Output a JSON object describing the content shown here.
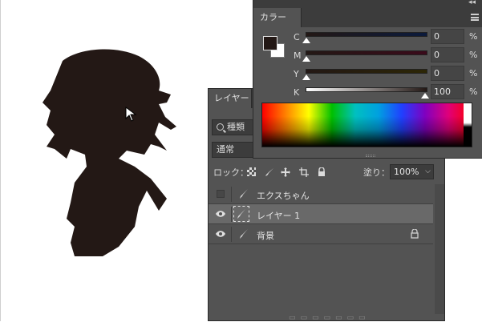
{
  "layers_panel": {
    "tab_label": "レイヤー",
    "kind_label": "種類",
    "blend_mode": "通常",
    "lock_label": "ロック：",
    "fill_label": "塗り：",
    "fill_value": "100%",
    "layers": [
      {
        "name": "エクスちゃん",
        "visible": false,
        "selected": false,
        "locked": false
      },
      {
        "name": "レイヤー 1",
        "visible": true,
        "selected": true,
        "locked": false
      },
      {
        "name": "背景",
        "visible": true,
        "selected": false,
        "locked": true
      }
    ]
  },
  "color_panel": {
    "tab_label": "カラー",
    "foreground_color": "#231815",
    "background_color": "#ffffff",
    "sliders": [
      {
        "label": "C",
        "value": "0",
        "unit": "%"
      },
      {
        "label": "M",
        "value": "0",
        "unit": "%"
      },
      {
        "label": "Y",
        "value": "0",
        "unit": "%"
      },
      {
        "label": "K",
        "value": "100",
        "unit": "%"
      }
    ]
  },
  "icons": [
    "search-icon",
    "eye-icon",
    "brush-icon",
    "lock-icon",
    "menu-icon",
    "collapse-icon",
    "arrow-cursor-icon"
  ]
}
